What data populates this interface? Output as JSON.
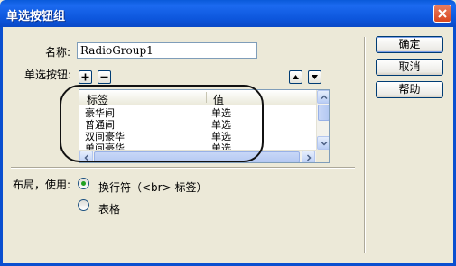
{
  "window": {
    "title": "单选按钮组"
  },
  "form": {
    "name_label": "名称:",
    "name_value": "RadioGroup1",
    "buttons_label": "单选按钮:"
  },
  "list": {
    "columns": [
      "标签",
      "值"
    ],
    "rows": [
      {
        "label": "豪华间",
        "value": "单选"
      },
      {
        "label": "普通间",
        "value": "单选"
      },
      {
        "label": "双间豪华",
        "value": "单选"
      },
      {
        "label": "单间豪华",
        "value": "单选"
      }
    ]
  },
  "layout": {
    "label": "布局，使用:",
    "options": [
      "换行符（<br> 标签）",
      "表格"
    ],
    "selected_index": 0
  },
  "actions": {
    "ok": "确定",
    "cancel": "取消",
    "help": "帮助"
  },
  "colors": {
    "title_bar": "#0a5ad9",
    "dialog_bg": "#ece9d8",
    "radio_selected": "#21a121"
  }
}
